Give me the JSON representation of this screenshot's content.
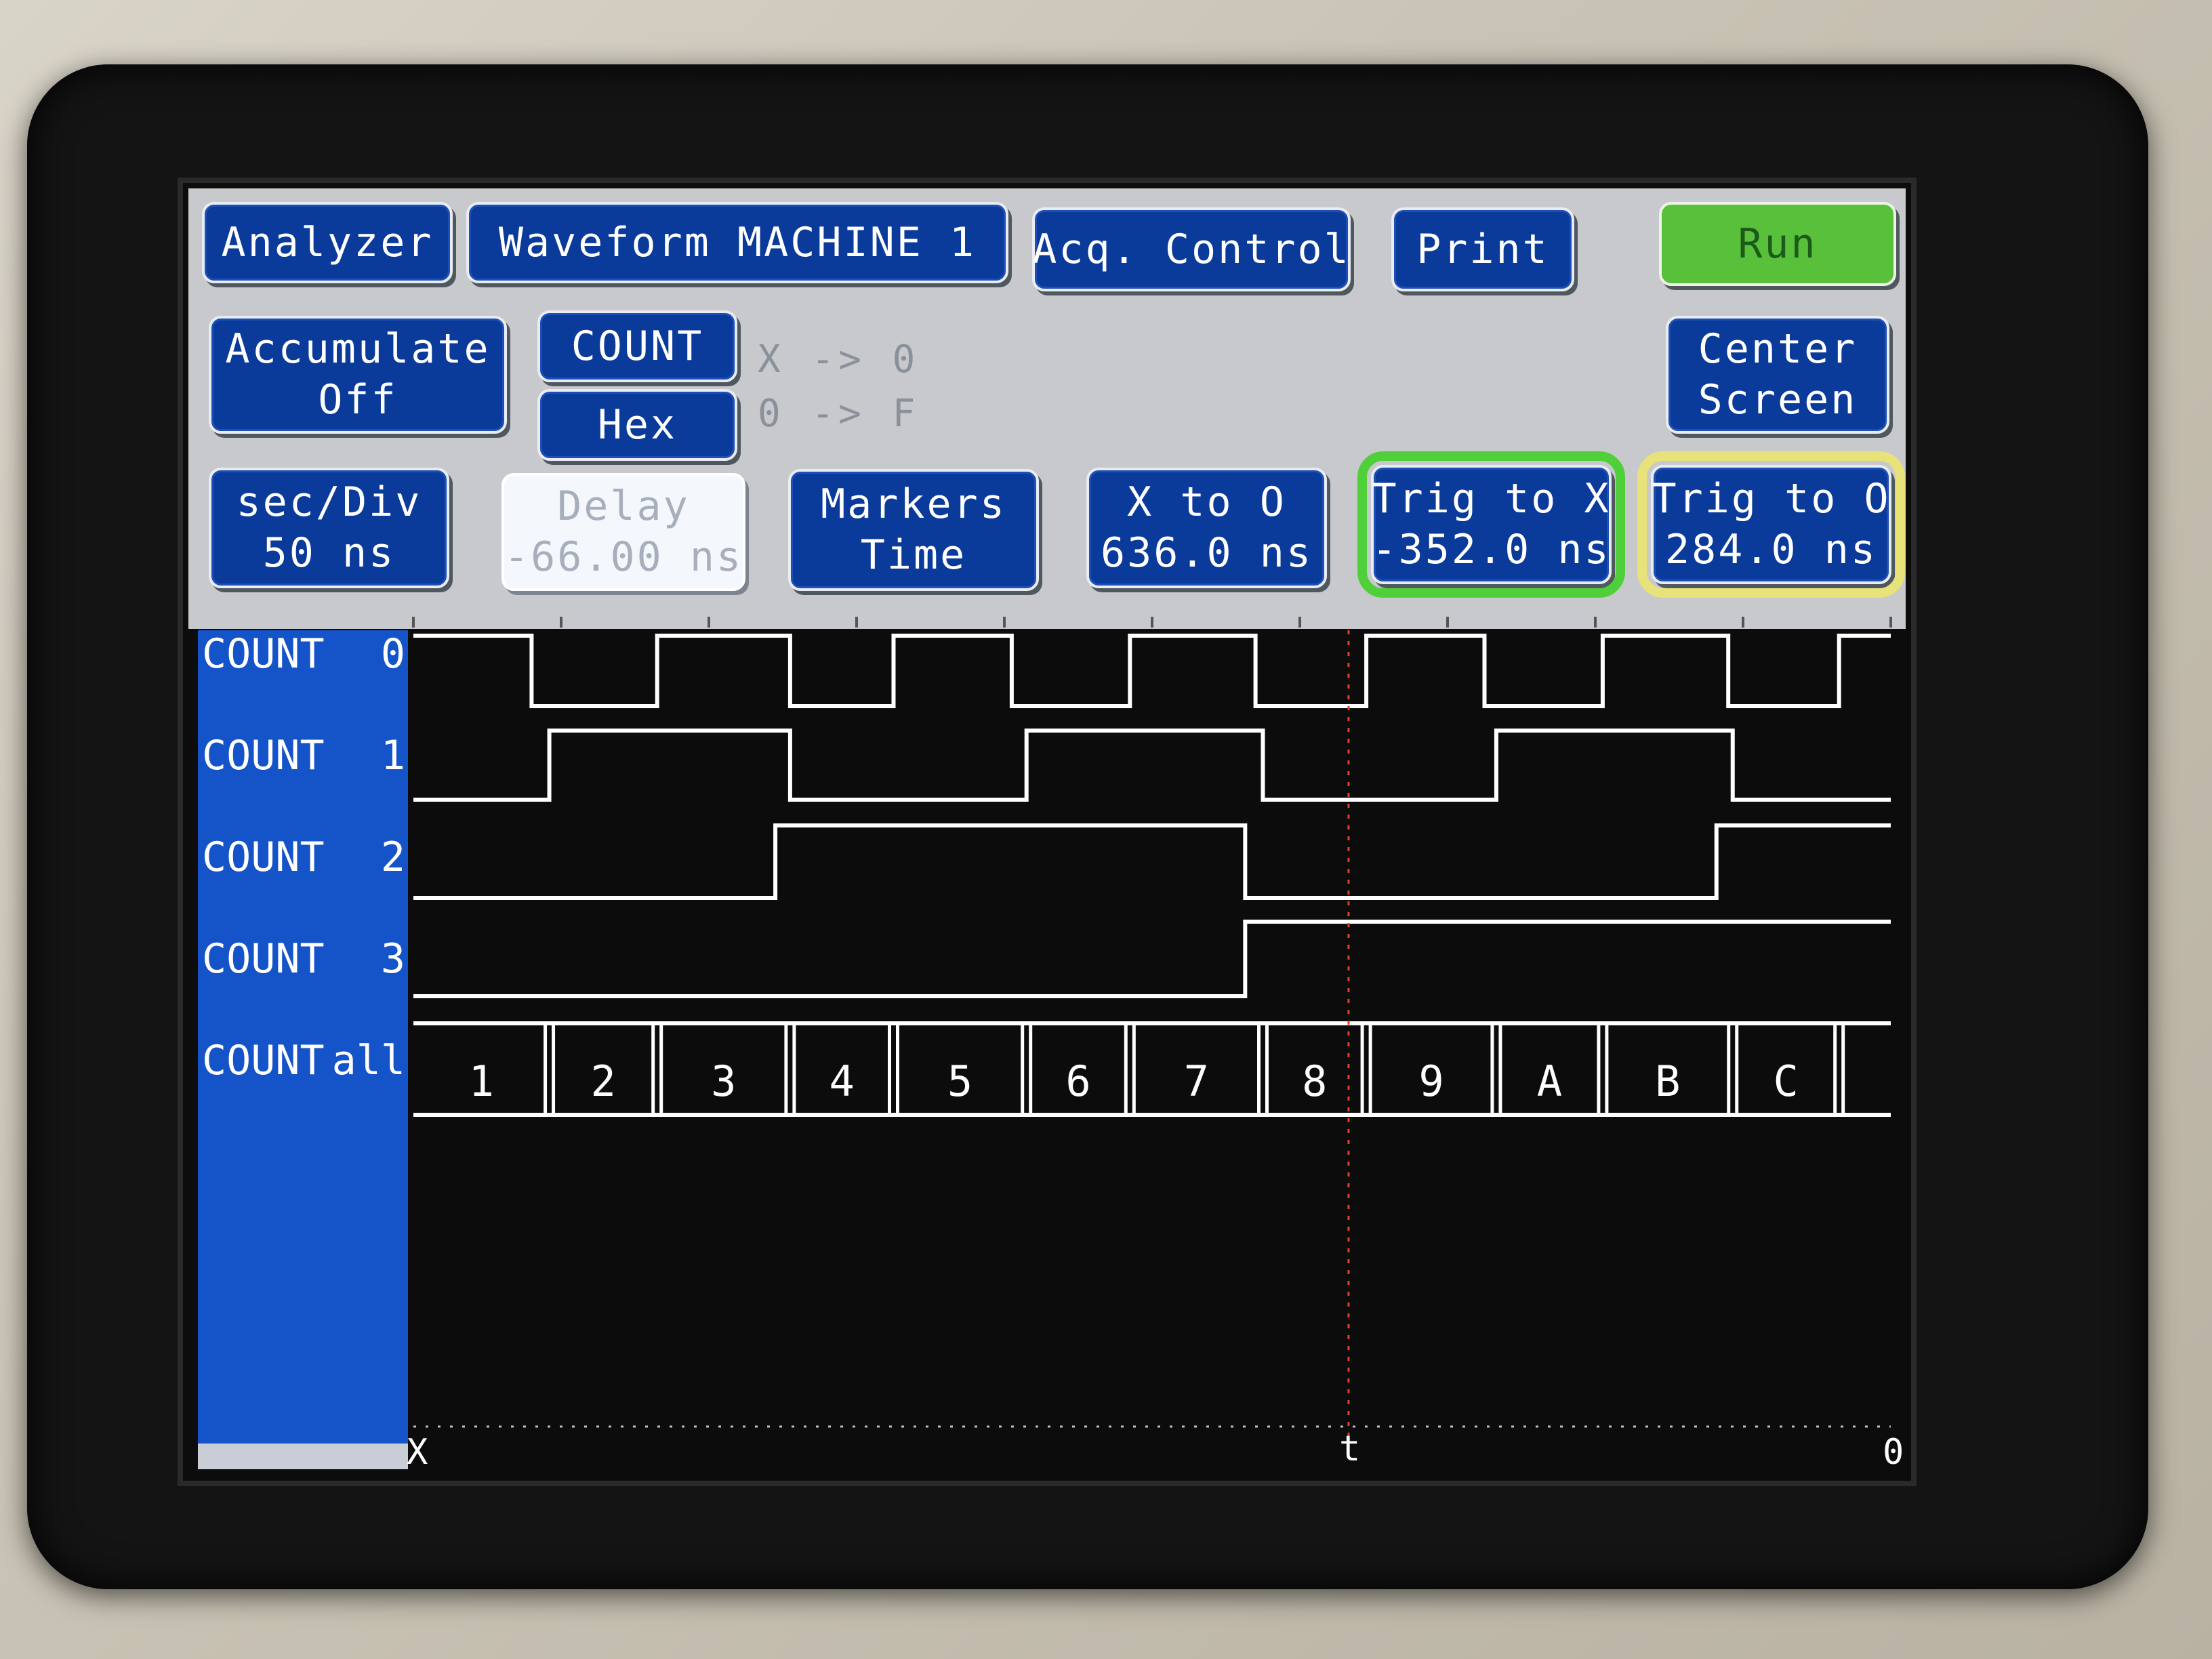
{
  "toolbar": {
    "analyzer": "Analyzer",
    "waveform": "Waveform MACHINE 1",
    "acq_control": "Acq. Control",
    "print": "Print",
    "run": "Run"
  },
  "controls": {
    "accumulate_line1": "Accumulate",
    "accumulate_line2": "Off",
    "label_select": "COUNT",
    "base_select": "Hex",
    "pattern_x": "X -> 0",
    "pattern_o": "0 -> F",
    "center_line1": "Center",
    "center_line2": "Screen",
    "secdiv_line1": "sec/Div",
    "secdiv_line2": "50 ns",
    "delay_line1": "Delay",
    "delay_line2": "-66.00 ns",
    "markers_line1": "Markers",
    "markers_line2": "Time",
    "xto0_line1": "X to O",
    "xto0_line2": "636.0 ns",
    "trigx_line1": "Trig to X",
    "trigx_line2": "-352.0 ns",
    "trigo_line1": "Trig to O",
    "trigo_line2": "284.0 ns"
  },
  "channels": [
    {
      "name": "COUNT",
      "index": "0",
      "transitions": [
        0.08,
        0.165,
        0.255,
        0.325,
        0.405,
        0.485,
        0.57,
        0.645,
        0.725,
        0.805,
        0.89,
        0.965
      ],
      "initial": 1
    },
    {
      "name": "COUNT",
      "index": "1",
      "transitions": [
        0.092,
        0.255,
        0.415,
        0.575,
        0.733,
        0.893
      ],
      "initial": 0
    },
    {
      "name": "COUNT",
      "index": "2",
      "transitions": [
        0.245,
        0.563,
        0.882
      ],
      "initial": 0
    },
    {
      "name": "COUNT",
      "index": "3",
      "transitions": [
        0.563
      ],
      "initial": 0
    }
  ],
  "bus": {
    "name": "COUNT",
    "index": "all",
    "values": [
      "1",
      "2",
      "3",
      "4",
      "5",
      "6",
      "7",
      "8",
      "9",
      "A",
      "B",
      "C",
      ""
    ],
    "boundaries": [
      0.0,
      0.092,
      0.165,
      0.255,
      0.325,
      0.415,
      0.485,
      0.575,
      0.645,
      0.733,
      0.805,
      0.893,
      0.965,
      1.0
    ]
  },
  "markers": {
    "x_label": "X",
    "trigger_label": "t",
    "o_label": "0",
    "trigger_position": 0.633
  },
  "colors": {
    "button_blue": "#0a3a9a",
    "run_green": "#58c03a",
    "label_column": "#1553c9",
    "trace": "#ffffff",
    "trigger_marker": "#e0402a"
  }
}
